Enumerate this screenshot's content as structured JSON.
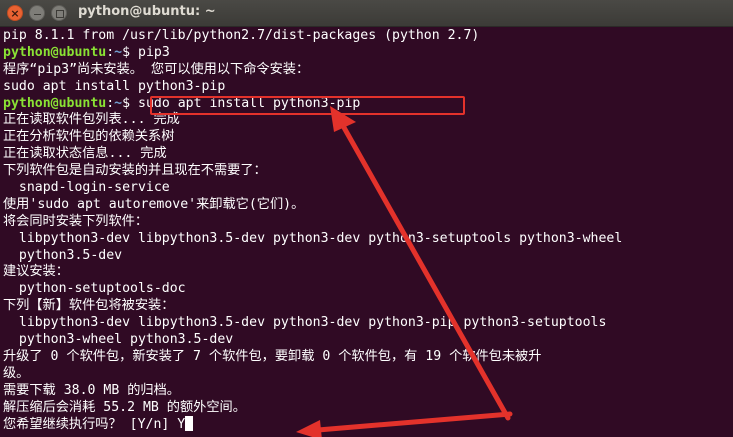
{
  "window": {
    "title": "python@ubuntu: ~",
    "close_glyph": "×"
  },
  "terminal": {
    "prompt": {
      "user": "python@ubuntu",
      "colon": ":",
      "path": "~",
      "sign": "$ "
    },
    "lines": [
      {
        "type": "output",
        "text": "pip 8.1.1 from /usr/lib/python2.7/dist-packages (python 2.7)"
      },
      {
        "type": "prompt",
        "command": "pip3"
      },
      {
        "type": "output",
        "text": "程序“pip3”尚未安装。 您可以使用以下命令安装："
      },
      {
        "type": "output",
        "text": "sudo apt install python3-pip"
      },
      {
        "type": "prompt",
        "command": "sudo apt install python3-pip"
      },
      {
        "type": "output",
        "text": "正在读取软件包列表... 完成"
      },
      {
        "type": "output",
        "text": "正在分析软件包的依赖关系树"
      },
      {
        "type": "output",
        "text": "正在读取状态信息... 完成"
      },
      {
        "type": "output",
        "text": "下列软件包是自动安装的并且现在不需要了："
      },
      {
        "type": "output",
        "text": "  snapd-login-service"
      },
      {
        "type": "output",
        "text": "使用'sudo apt autoremove'来卸载它(它们)。"
      },
      {
        "type": "output",
        "text": "将会同时安装下列软件："
      },
      {
        "type": "output",
        "text": "  libpython3-dev libpython3.5-dev python3-dev python3-setuptools python3-wheel"
      },
      {
        "type": "output",
        "text": "  python3.5-dev"
      },
      {
        "type": "output",
        "text": "建议安装："
      },
      {
        "type": "output",
        "text": "  python-setuptools-doc"
      },
      {
        "type": "output",
        "text": "下列【新】软件包将被安装："
      },
      {
        "type": "output",
        "text": "  libpython3-dev libpython3.5-dev python3-dev python3-pip python3-setuptools"
      },
      {
        "type": "output",
        "text": "  python3-wheel python3.5-dev"
      },
      {
        "type": "output",
        "text": "升级了 0 个软件包，新安装了 7 个软件包，要卸载 0 个软件包，有 19 个软件包未被升"
      },
      {
        "type": "output",
        "text": "级。"
      },
      {
        "type": "output",
        "text": "需要下载 38.0 MB 的归档。"
      },
      {
        "type": "output",
        "text": "解压缩后会消耗 55.2 MB 的额外空间。"
      },
      {
        "type": "input",
        "text": "您希望继续执行吗？ [Y/n] Y"
      }
    ]
  },
  "colors": {
    "background": "#300a24",
    "prompt_user": "#8ae234",
    "prompt_path": "#729fcf",
    "annotation": "#e3322b"
  }
}
